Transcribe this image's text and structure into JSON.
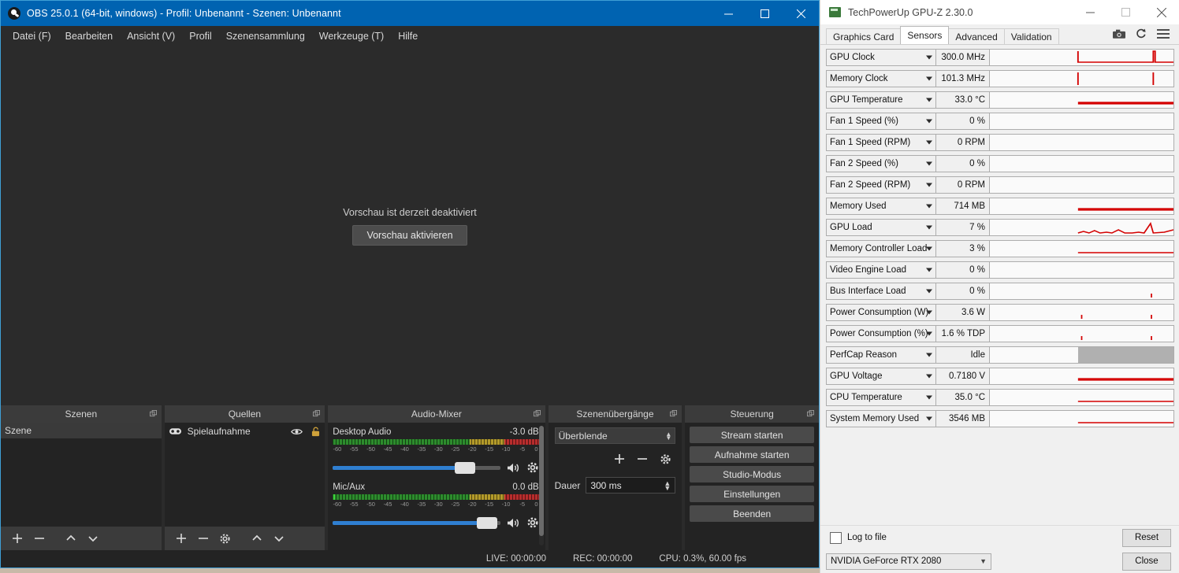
{
  "obs": {
    "title": "OBS 25.0.1 (64-bit, windows) - Profil: Unbenannt - Szenen: Unbenannt",
    "window_buttons": {
      "minimize": "minimize-icon",
      "maximize": "maximize-icon",
      "close": "close-icon"
    },
    "menu": [
      "Datei (F)",
      "Bearbeiten",
      "Ansicht (V)",
      "Profil",
      "Szenensammlung",
      "Werkzeuge (T)",
      "Hilfe"
    ],
    "preview": {
      "message": "Vorschau ist derzeit deaktiviert",
      "enable_button": "Vorschau aktivieren"
    },
    "scenes": {
      "title": "Szenen",
      "items": [
        "Szene"
      ],
      "toolbar": [
        "add-icon",
        "remove-icon",
        "move-up-icon",
        "move-down-icon"
      ]
    },
    "sources": {
      "title": "Quellen",
      "items": [
        {
          "name": "Spielaufnahme",
          "type_icon": "gamepad-icon",
          "visible": true,
          "locked": false
        }
      ],
      "toolbar": [
        "add-icon",
        "remove-icon",
        "properties-icon",
        "move-up-icon",
        "move-down-icon"
      ]
    },
    "mixer": {
      "title": "Audio-Mixer",
      "scale_ticks": [
        "-60",
        "-55",
        "-50",
        "-45",
        "-40",
        "-35",
        "-30",
        "-25",
        "-20",
        "-15",
        "-10",
        "-5",
        "0"
      ],
      "tracks": [
        {
          "name": "Desktop Audio",
          "db": "-3.0 dB",
          "fader_percent": 79,
          "muted": false
        },
        {
          "name": "Mic/Aux",
          "db": "0.0 dB",
          "fader_percent": 93,
          "muted": false
        }
      ]
    },
    "transitions": {
      "title": "Szenenübergänge",
      "selected": "Überblende",
      "duration_label": "Dauer",
      "duration_value": "300 ms",
      "toolbar": [
        "add-icon",
        "remove-icon",
        "properties-icon"
      ]
    },
    "controls": {
      "title": "Steuerung",
      "buttons": [
        "Stream starten",
        "Aufnahme starten",
        "Studio-Modus",
        "Einstellungen",
        "Beenden"
      ]
    },
    "status": {
      "live": "LIVE: 00:00:00",
      "rec": "REC: 00:00:00",
      "cpu": "CPU: 0.3%, 60.00 fps"
    }
  },
  "gpuz": {
    "title": "TechPowerUp GPU-Z 2.30.0",
    "window_buttons": {
      "minimize": "minimize-icon",
      "maximize": "maximize-icon",
      "close": "close-icon"
    },
    "tabs": [
      {
        "label": "Graphics Card",
        "active": false
      },
      {
        "label": "Sensors",
        "active": true
      },
      {
        "label": "Advanced",
        "active": false
      },
      {
        "label": "Validation",
        "active": false
      }
    ],
    "tab_icons": [
      "camera-icon",
      "refresh-icon",
      "menu-icon"
    ],
    "sensors": [
      {
        "name": "GPU Clock",
        "value": "300.0 MHz",
        "graph": "spike-pair-high"
      },
      {
        "name": "Memory Clock",
        "value": "101.3 MHz",
        "graph": "two-spikes"
      },
      {
        "name": "GPU Temperature",
        "value": "33.0 °C",
        "graph": "flat-thick"
      },
      {
        "name": "Fan 1 Speed (%)",
        "value": "0 %",
        "graph": "empty"
      },
      {
        "name": "Fan 1 Speed (RPM)",
        "value": "0 RPM",
        "graph": "empty"
      },
      {
        "name": "Fan 2 Speed (%)",
        "value": "0 %",
        "graph": "empty"
      },
      {
        "name": "Fan 2 Speed (RPM)",
        "value": "0 RPM",
        "graph": "empty"
      },
      {
        "name": "Memory Used",
        "value": "714 MB",
        "graph": "flat-thick"
      },
      {
        "name": "GPU Load",
        "value": "7 %",
        "graph": "noisy-low"
      },
      {
        "name": "Memory Controller Load",
        "value": "3 %",
        "graph": "flat-thin"
      },
      {
        "name": "Video Engine Load",
        "value": "0 %",
        "graph": "empty"
      },
      {
        "name": "Bus Interface Load",
        "value": "0 %",
        "graph": "tiny-tick"
      },
      {
        "name": "Power Consumption (W)",
        "value": "3.6 W",
        "graph": "two-tiny"
      },
      {
        "name": "Power Consumption (%)",
        "value": "1.6 % TDP",
        "graph": "two-tiny"
      },
      {
        "name": "PerfCap Reason",
        "value": "Idle",
        "graph": "gray-fill"
      },
      {
        "name": "GPU Voltage",
        "value": "0.7180 V",
        "graph": "flat-thick"
      },
      {
        "name": "CPU Temperature",
        "value": "35.0 °C",
        "graph": "flat-thin"
      },
      {
        "name": "System Memory Used",
        "value": "3546 MB",
        "graph": "flat-thin"
      }
    ],
    "log_to_file": {
      "label": "Log to file",
      "checked": false
    },
    "reset_button": "Reset",
    "gpu_select": "NVIDIA GeForce RTX 2080",
    "close_button": "Close"
  }
}
